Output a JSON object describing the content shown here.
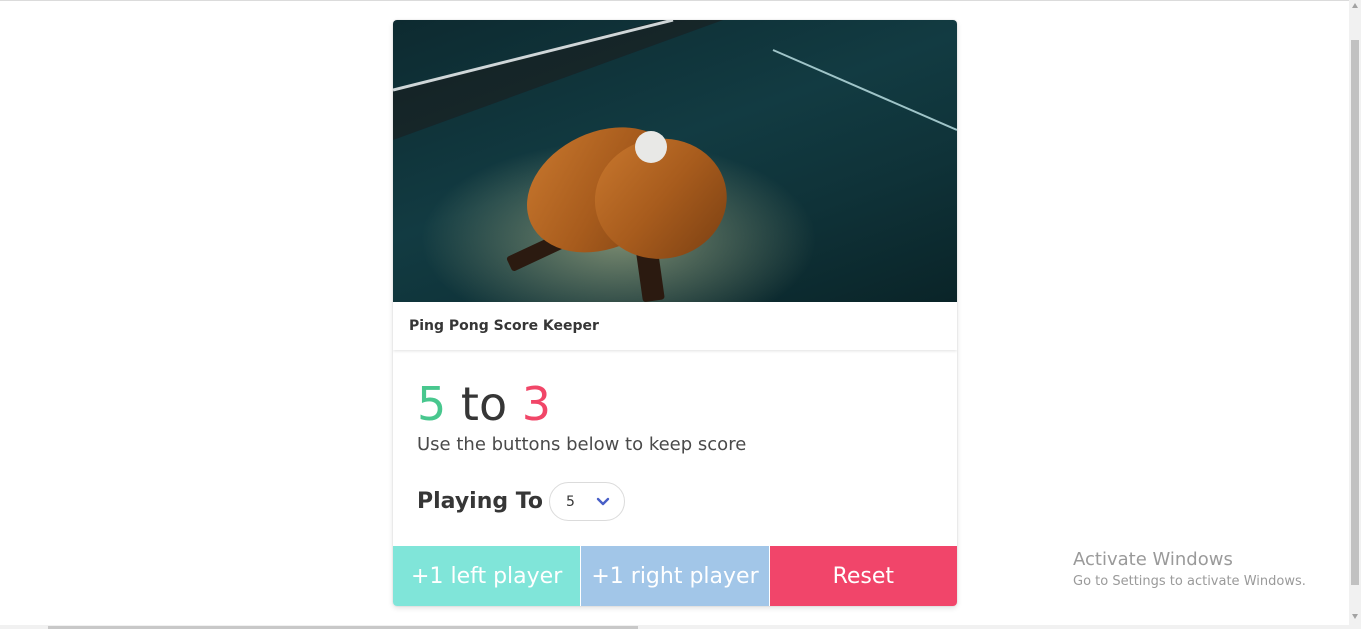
{
  "card": {
    "title": "Ping Pong Score Keeper",
    "image_alt": "ping-pong paddles on table"
  },
  "score": {
    "left": "5",
    "separator": "to",
    "right": "3",
    "left_color": "#48c78e",
    "right_color": "#f14668"
  },
  "instructions": "Use the buttons below to keep score",
  "playing_to": {
    "label": "Playing To",
    "selected": "5"
  },
  "buttons": {
    "left": "+1 left player",
    "right": "+1 right player",
    "reset": "Reset"
  },
  "watermark": {
    "title": "Activate Windows",
    "subtitle": "Go to Settings to activate Windows."
  }
}
